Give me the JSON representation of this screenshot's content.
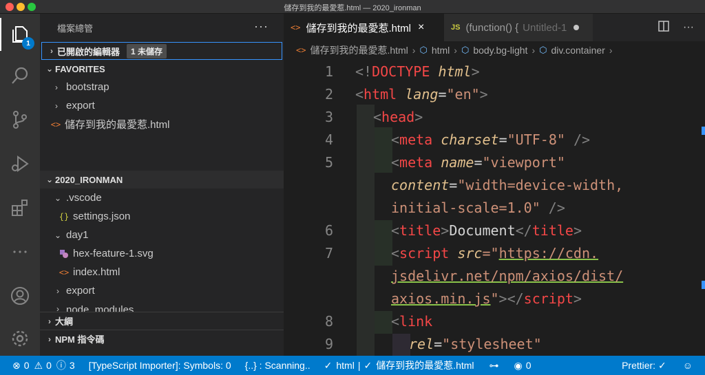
{
  "window": {
    "title": "儲存到我的最愛惹.html — 2020_ironman"
  },
  "activity": {
    "explorer_badge": "1"
  },
  "sidebar": {
    "title": "檔案總管",
    "more": "···",
    "open_editors": {
      "label": "已開啟的編輯器",
      "unsaved": "1 未儲存"
    },
    "favorites": {
      "label": "FAVORITES",
      "items": [
        {
          "name": "bootstrap"
        },
        {
          "name": "export"
        },
        {
          "name": "儲存到我的最愛惹.html"
        }
      ]
    },
    "workspace": {
      "label": "2020_IRONMAN",
      "items": [
        {
          "name": ".vscode"
        },
        {
          "name": "settings.json"
        },
        {
          "name": "day1"
        },
        {
          "name": "hex-feature-1.svg"
        },
        {
          "name": "index.html"
        },
        {
          "name": "export"
        },
        {
          "name": "node_modules"
        }
      ]
    },
    "outline": {
      "label": "大綱"
    },
    "npm": {
      "label": "NPM 指令碼"
    }
  },
  "tabs": [
    {
      "label": "儲存到我的最愛惹.html",
      "close": "×"
    },
    {
      "label": "(function() {",
      "suffix": "Untitled-1"
    }
  ],
  "breadcrumb": [
    "儲存到我的最愛惹.html",
    "html",
    "body.bg-light",
    "div.container"
  ],
  "code": {
    "line_numbers": [
      "1",
      "2",
      "3",
      "4",
      "5",
      "6",
      "7",
      "8",
      "9"
    ],
    "l1": {
      "a": "<!",
      "b": "DOCTYPE",
      "c": " ",
      "d": "html",
      "e": ">"
    },
    "l2": {
      "a": "<",
      "b": "html",
      "c": " ",
      "d": "lang",
      "e": "=",
      "f": "\"en\"",
      "g": ">"
    },
    "l3": {
      "a": "<",
      "b": "head",
      "c": ">"
    },
    "l4": {
      "a": "<",
      "b": "meta",
      "c": " ",
      "d": "charset",
      "e": "=",
      "f": "\"UTF-8\"",
      "g": " />"
    },
    "l5": {
      "a": "<",
      "b": "meta",
      "c": " ",
      "d": "name",
      "e": "=",
      "f": "\"viewport\""
    },
    "l5b": {
      "a": "content",
      "b": "=",
      "c": "\"width=device-width,"
    },
    "l5c": {
      "a": "initial-scale=1.0\"",
      "b": " />"
    },
    "l6": {
      "a": "<",
      "b": "title",
      "c": ">",
      "d": "Document",
      "e": "</",
      "f": "title",
      "g": ">"
    },
    "l7": {
      "a": "<",
      "b": "script",
      "c": " ",
      "d": "src",
      "e": "=\"",
      "f": "https://cdn."
    },
    "l7b": {
      "a": "jsdelivr.net/npm/axios/dist/"
    },
    "l7c": {
      "a": "axios.min.js",
      "b": "\"",
      "c": "></",
      "d": "script",
      "e": ">"
    },
    "l8": {
      "a": "<",
      "b": "link"
    },
    "l9": {
      "a": "rel",
      "b": "=",
      "c": "\"stylesheet\""
    }
  },
  "status": {
    "errors": "0",
    "warnings": "0",
    "info": "3",
    "importer": "[TypeScript Importer]: Symbols: 0",
    "scanning": "{..} : Scanning..",
    "language": "html",
    "file": "儲存到我的最愛惹.html",
    "live": "0",
    "prettier": "Prettier: ✓"
  },
  "colors": {
    "statusbar": "#007acc",
    "accent": "#3794ff",
    "tag": "#f44747",
    "attr": "#e2c08d",
    "string": "#ce9178"
  }
}
